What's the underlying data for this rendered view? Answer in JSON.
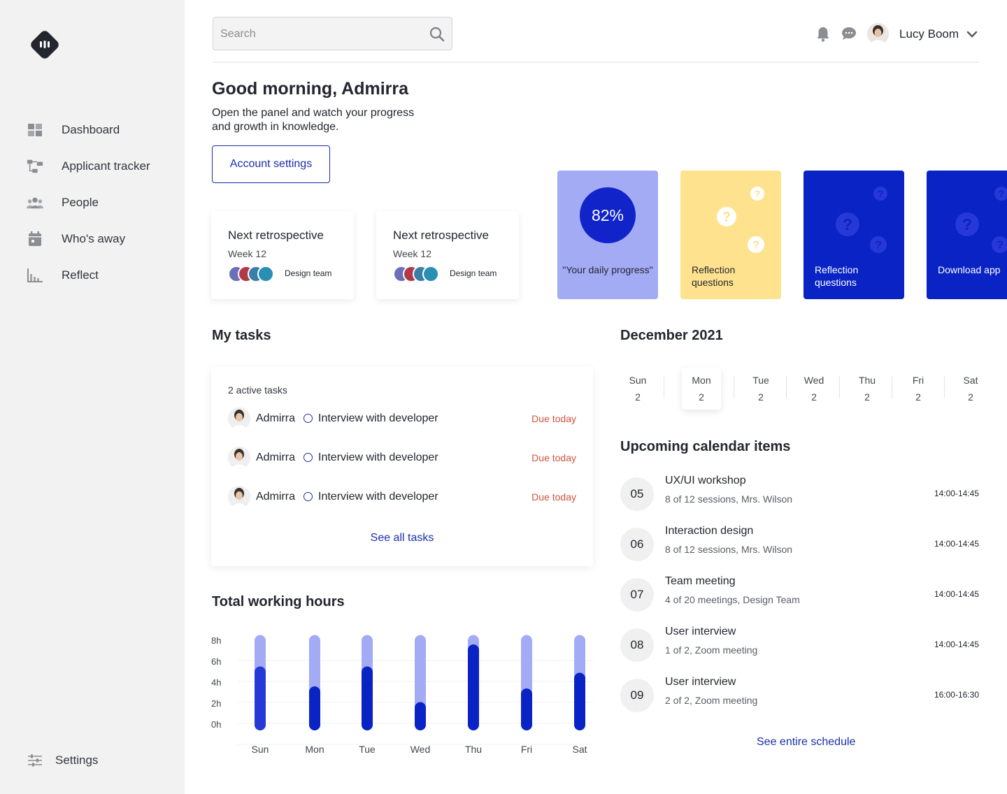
{
  "sidebar": {
    "logo": "app-logo",
    "items": [
      {
        "label": "Dashboard",
        "icon": "grid-icon"
      },
      {
        "label": "Applicant tracker",
        "icon": "flow-icon"
      },
      {
        "label": "People",
        "icon": "people-icon"
      },
      {
        "label": "Who's away",
        "icon": "calendar-icon"
      },
      {
        "label": "Reflect",
        "icon": "chart-icon"
      }
    ],
    "settings_label": "Settings"
  },
  "header": {
    "search_placeholder": "Search",
    "user_name": "Lucy Boom"
  },
  "greeting": {
    "title": "Good morning, Admirra",
    "subtitle": "Open the panel and watch your progress and growth in knowledge.",
    "account_button": "Account settings"
  },
  "retro_cards": [
    {
      "title": "Next retrospective",
      "week": "Week 12",
      "team": "Design team"
    },
    {
      "title": "Next retrospective",
      "week": "Week 12",
      "team": "Design team"
    }
  ],
  "cards": {
    "progress_value": "82%",
    "progress_label": "\"Your daily progress\"",
    "reflection_label_1": "Reflection questions",
    "reflection_label_2": "Reflection questions",
    "download_label": "Download app"
  },
  "colors": {
    "accent": "#1a2fa8",
    "progress_card": "#a4abf5",
    "yellow_card": "#ffe28e",
    "blue_card": "#0a23c4",
    "due": "#d0533c"
  },
  "tasks": {
    "title": "My tasks",
    "count_label": "2 active tasks",
    "items": [
      {
        "person": "Admirra",
        "task": "Interview with developer",
        "due": "Due today"
      },
      {
        "person": "Admirra",
        "task": "Interview with developer",
        "due": "Due today"
      },
      {
        "person": "Admirra",
        "task": "Interview with developer",
        "due": "Due today"
      }
    ],
    "see_all": "See all tasks"
  },
  "hours": {
    "title": "Total working hours"
  },
  "chart_data": {
    "type": "bar",
    "categories": [
      "Sun",
      "Mon",
      "Tue",
      "Wed",
      "Thu",
      "Fri",
      "Sat"
    ],
    "series": [
      {
        "values": [
          6.1,
          4.2,
          6.1,
          2.7,
          8.2,
          4.0,
          5.5
        ]
      }
    ],
    "max_per_bar": 9.1,
    "yticks": [
      "8h",
      "6h",
      "4h",
      "2h",
      "0h"
    ],
    "ylim": [
      0,
      8
    ]
  },
  "calendar": {
    "month": "December 2021",
    "days": [
      {
        "name": "Sun",
        "num": "2"
      },
      {
        "name": "Mon",
        "num": "2"
      },
      {
        "name": "Tue",
        "num": "2"
      },
      {
        "name": "Wed",
        "num": "2"
      },
      {
        "name": "Thu",
        "num": "2"
      },
      {
        "name": "Fri",
        "num": "2"
      },
      {
        "name": "Sat",
        "num": "2"
      }
    ],
    "upcoming_title": "Upcoming calendar items",
    "events": [
      {
        "date": "05",
        "title": "UX/UI workshop",
        "sub": "8 of 12 sessions, Mrs. Wilson",
        "time": "14:00-14:45"
      },
      {
        "date": "06",
        "title": "Interaction design",
        "sub": "8 of 12 sessions, Mrs. Wilson",
        "time": "14:00-14:45"
      },
      {
        "date": "07",
        "title": "Team meeting",
        "sub": "4 of 20 meetings, Design Team",
        "time": "14:00-14:45"
      },
      {
        "date": "08",
        "title": "User interview",
        "sub": "1 of 2, Zoom meeting",
        "time": "14:00-14:45"
      },
      {
        "date": "09",
        "title": "User interview",
        "sub": "2 of 2, Zoom meeting",
        "time": "16:00-16:30"
      }
    ],
    "see_schedule": "See entire schedule"
  }
}
